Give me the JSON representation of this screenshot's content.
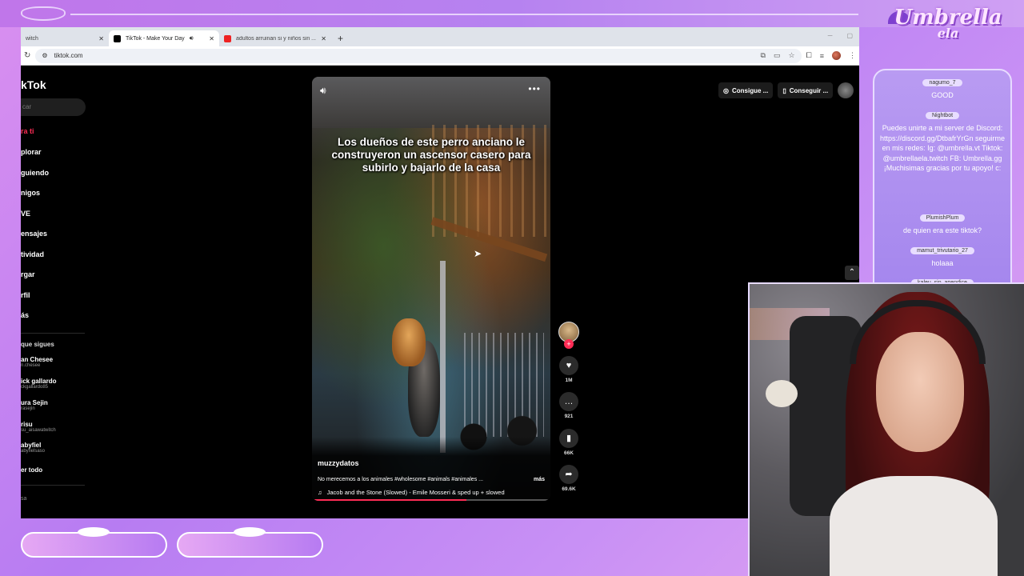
{
  "browser": {
    "tabs": [
      {
        "title": "witch",
        "active": false
      },
      {
        "title": "TikTok - Make Your Day",
        "active": true
      },
      {
        "title": "adultos arruinan si y niños sin ...",
        "active": false
      }
    ],
    "url": "tiktok.com"
  },
  "tiktok": {
    "logo": "kTok",
    "search_placeholder": "car",
    "nav": [
      "ra ti",
      "plorar",
      "guiendo",
      "nigos",
      "VE",
      "ensajes",
      "tividad",
      "rgar",
      "rfil",
      "ás"
    ],
    "following_heading": "que sigues",
    "following": [
      {
        "name": "an Chesee",
        "handle": "n.chesee"
      },
      {
        "name": "ick gallardo",
        "handle": "ckgallardo85"
      },
      {
        "name": "ura Sejin",
        "handle": "rasejin"
      },
      {
        "name": "risu",
        "handle": "su_aisawatwitch"
      },
      {
        "name": "abyfiel",
        "handle": "abyfielsaso"
      }
    ],
    "see_all": "er todo",
    "footer_snip": "sa",
    "get_coins": "Consigue ...",
    "get_app": "Conseguir ...",
    "video": {
      "caption": "Los dueños de este perro anciano le construyeron un ascensor casero para subirlo y bajarlo de la casa",
      "author": "muzzydatos",
      "description": "No merecemos a los animales #wholesome #animals #animales ...",
      "more": "más",
      "music": "Jacob and the Stone (Slowed) - Emile Mosseri & sped up + slowed",
      "progress": 0.65
    },
    "counts": {
      "likes": "1M",
      "comments": "921",
      "saves": "66K",
      "shares": "69.6K"
    }
  },
  "chat": {
    "brand_top": "Umbrella",
    "brand_bottom": "ela",
    "messages": [
      {
        "user": "nagumo_7",
        "text": "GOOD"
      },
      {
        "user": "Nightbot",
        "text": "Puedes unirte a mi server de Discord: https://discord.gg/DtbafrYrGn seguirme en mis redes: Ig: @umbrella.vt Tiktok: @umbrellaela.twitch FB: Umbrella.gg ¡Muchisimas gracias por tu apoyo! c:"
      },
      {
        "user": "PlumishPlum",
        "text": "de quien era este tiktok?"
      },
      {
        "user": "mamut_trivutario_27",
        "text": "holaaa"
      },
      {
        "user": "kaleu_sin_apendice",
        "text": ""
      }
    ]
  },
  "colors": {
    "accent": "#fe2c55",
    "overlay": "#b77cf2"
  }
}
